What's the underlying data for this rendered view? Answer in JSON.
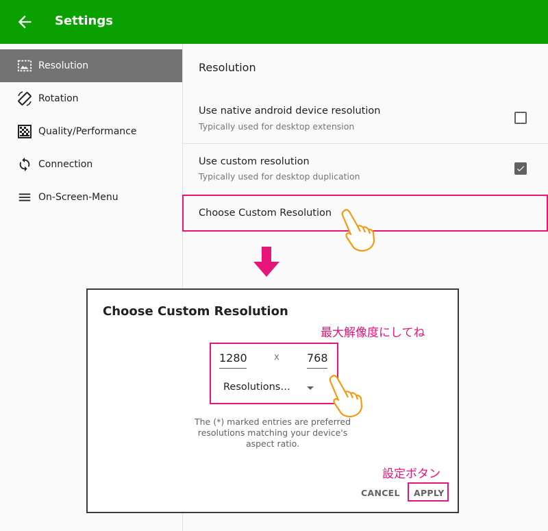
{
  "appbar": {
    "title": "Settings",
    "back_icon": "arrow-left-icon",
    "color": "#0aa100"
  },
  "sidebar": {
    "items": [
      {
        "label": "Resolution",
        "icon": "resolution-icon",
        "active": true
      },
      {
        "label": "Rotation",
        "icon": "rotation-icon",
        "active": false
      },
      {
        "label": "Quality/Performance",
        "icon": "quality-icon",
        "active": false
      },
      {
        "label": "Connection",
        "icon": "sync-icon",
        "active": false
      },
      {
        "label": "On-Screen-Menu",
        "icon": "menu-icon",
        "active": false
      }
    ]
  },
  "content": {
    "section_title": "Resolution",
    "prefs": [
      {
        "title": "Use native android device resolution",
        "subtitle": "Typically used for desktop extension",
        "checked": false
      },
      {
        "title": "Use custom resolution",
        "subtitle": "Typically used for desktop duplication",
        "checked": true
      },
      {
        "title": "Choose Custom Resolution"
      }
    ]
  },
  "dialog": {
    "title": "Choose Custom Resolution",
    "annotation_top": "最大解像度にしてね",
    "width_value": "1280",
    "separator": "x",
    "height_value": "768",
    "select_label": "Resolutions…",
    "help_text": "The (*) marked entries are preferred resolutions matching your device's aspect ratio.",
    "annotation_bottom": "設定ボタン",
    "cancel_label": "CANCEL",
    "apply_label": "APPLY"
  },
  "accent_color": "#e5157a"
}
